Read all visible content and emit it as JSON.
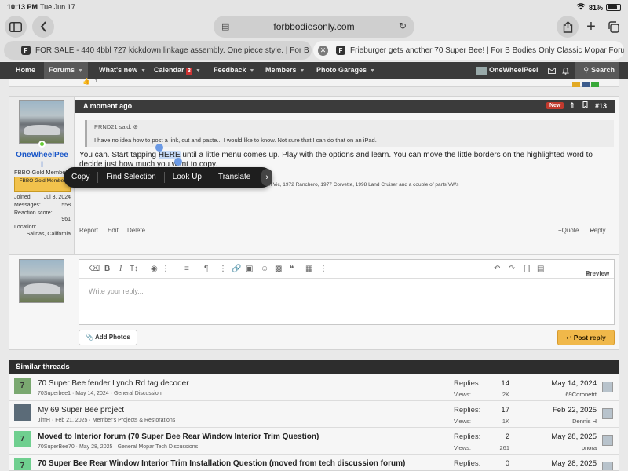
{
  "status": {
    "time": "10:13 PM",
    "date": "Tue Jun 17",
    "battery": "81%",
    "battery_level": 0.81
  },
  "browser": {
    "url": "forbbodiesonly.com",
    "tabs": [
      {
        "label": "FOR SALE - 440 4bbl 727 kickdown linkage assembly. One piece style. | For B Bod..."
      },
      {
        "label": "Frieburger gets another 70 Super Bee! | For B Bodies Only Classic Mopar Forum"
      }
    ]
  },
  "nav": {
    "home": "Home",
    "forums": "Forums",
    "whats_new": "What's new",
    "calendar": "Calendar",
    "calendar_count": "3",
    "feedback": "Feedback",
    "members": "Members",
    "photo_garages": "Photo Garages",
    "account_name": "OneWheelPeel",
    "search": "Search"
  },
  "prev_post": {
    "reaction_count": "1"
  },
  "post": {
    "time": "A moment ago",
    "new_label": "New",
    "number": "#13",
    "quote_author": "PRND21 said:",
    "quote_text": "I have no idea how to post a link, cut and paste... I would like to know. Not sure that I can do that on an iPad.",
    "message_before": "You can. Start tapping ",
    "message_selected": "HERE",
    "message_after": " until a little menu comes up. Play with the options and learn. You can move the little borders on the highlighted word to decide just how much you want to copy.",
    "signature": "Currently held (because I have no common sense) 1984 Daytona Turbo, 2000 Crown Vic, 1972 Ranchero, 1977 Corvette, 1998 Land Cruiser and a couple of parts VWs",
    "report": "Report",
    "edit": "Edit",
    "delete": "Delete",
    "quote_action": "+Quote",
    "reply_action": "Reply"
  },
  "user": {
    "name_line1": "OneWheelPee",
    "name_line2": "l",
    "title": "FBBO Gold Member",
    "banner": "FBBO Gold Member",
    "joined_label": "Joined:",
    "joined_value": "Jul 3, 2024",
    "messages_label": "Messages:",
    "messages_value": "558",
    "reaction_label": "Reaction score:",
    "reaction_value": "961",
    "location_label": "Location:",
    "location_value": "Salinas, California"
  },
  "context_menu": {
    "copy": "Copy",
    "find": "Find Selection",
    "lookup": "Look Up",
    "translate": "Translate"
  },
  "reply": {
    "placeholder": "Write your reply...",
    "preview": "Preview",
    "add_photos": "Add Photos",
    "post_reply": "Post reply"
  },
  "similar": {
    "heading": "Similar threads",
    "replies_label": "Replies:",
    "views_label": "Views:",
    "threads": [
      {
        "title": "70 Super Bee fender Lynch Rd tag decoder",
        "author": "70Superbee1",
        "date": "May 14, 2024",
        "forum": "General Discussion",
        "replies": "14",
        "views": "2K",
        "last_date": "May 14, 2024",
        "last_user": "69Coronetrt",
        "avatar_letter": "7",
        "avatar_color": "#7aa870",
        "bold": false
      },
      {
        "title": "My 69 Super Bee project",
        "author": "JimH",
        "date": "Feb 21, 2025",
        "forum": "Member's Projects & Restorations",
        "replies": "17",
        "views": "1K",
        "last_date": "Feb 22, 2025",
        "last_user": "Dennis H",
        "avatar_letter": "",
        "avatar_color": "#5b6b78",
        "bold": false
      },
      {
        "title": "Moved to Interior forum (70 Super Bee Rear Window Interior Trim Question)",
        "author": "70SuperBee70",
        "date": "May 28, 2025",
        "forum": "General Mopar Tech Discussions",
        "replies": "2",
        "views": "261",
        "last_date": "May 28, 2025",
        "last_user": "pnora",
        "avatar_letter": "7",
        "avatar_color": "#6fcf8f",
        "bold": true
      },
      {
        "title": "70 Super Bee Rear Window Interior Trim Installation Question (moved from tech discussion forum)",
        "author": "",
        "date": "",
        "forum": "",
        "replies": "0",
        "views": "",
        "last_date": "May 28, 2025",
        "last_user": "",
        "avatar_letter": "7",
        "avatar_color": "#6fcf8f",
        "bold": true
      }
    ]
  }
}
